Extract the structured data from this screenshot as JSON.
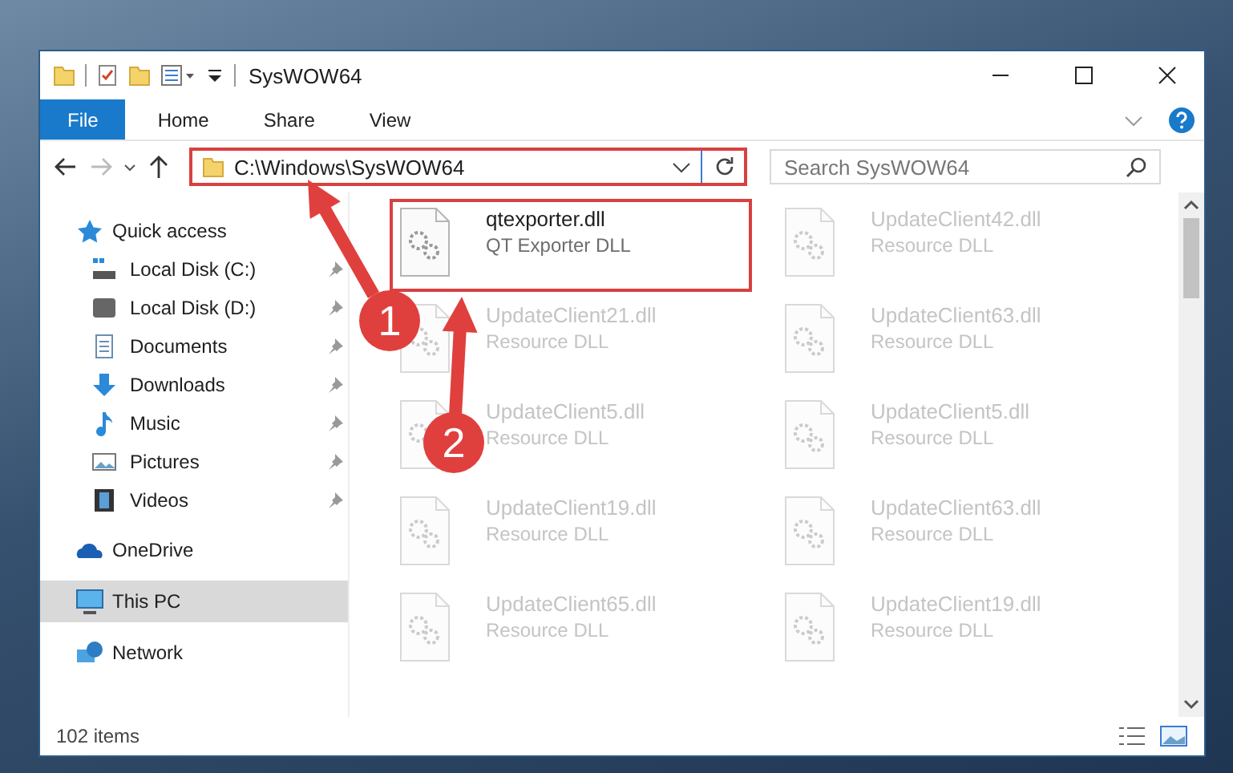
{
  "window": {
    "title": "SysWOW64"
  },
  "ribbon": {
    "tabs": [
      {
        "label": "File",
        "selected": true
      },
      {
        "label": "Home",
        "selected": false
      },
      {
        "label": "Share",
        "selected": false
      },
      {
        "label": "View",
        "selected": false
      }
    ]
  },
  "address_bar": {
    "path": "C:\\Windows\\SysWOW64",
    "highlighted": true
  },
  "search": {
    "placeholder": "Search SysWOW64"
  },
  "sidebar": {
    "items": [
      {
        "label": "Quick access",
        "selected": false,
        "children": [
          {
            "label": "Local Disk (C:)",
            "pinned": true,
            "selected": false
          },
          {
            "label": "Local Disk (D:)",
            "pinned": true,
            "selected": false
          },
          {
            "label": "Documents",
            "pinned": true,
            "selected": false
          },
          {
            "label": "Downloads",
            "pinned": true,
            "selected": false
          },
          {
            "label": "Music",
            "pinned": true,
            "selected": false
          },
          {
            "label": "Pictures",
            "pinned": true,
            "selected": false
          },
          {
            "label": "Videos",
            "pinned": true,
            "selected": false
          }
        ]
      },
      {
        "label": "OneDrive",
        "selected": false
      },
      {
        "label": "This PC",
        "selected": true
      },
      {
        "label": "Network",
        "selected": false
      }
    ]
  },
  "files": [
    {
      "name": "qtexporter.dll",
      "type": "QT Exporter DLL",
      "dimmed": false,
      "highlighted": true
    },
    {
      "name": "UpdateClient42.dll",
      "type": "Resource DLL",
      "dimmed": true,
      "highlighted": false
    },
    {
      "name": "UpdateClient21.dll",
      "type": "Resource DLL",
      "dimmed": true,
      "highlighted": false
    },
    {
      "name": "UpdateClient63.dll",
      "type": "Resource DLL",
      "dimmed": true,
      "highlighted": false
    },
    {
      "name": "UpdateClient5.dll",
      "type": "Resource DLL",
      "dimmed": true,
      "highlighted": false
    },
    {
      "name": "UpdateClient5.dll",
      "type": "Resource DLL",
      "dimmed": true,
      "highlighted": false
    },
    {
      "name": "UpdateClient19.dll",
      "type": "Resource DLL",
      "dimmed": true,
      "highlighted": false
    },
    {
      "name": "UpdateClient63.dll",
      "type": "Resource DLL",
      "dimmed": true,
      "highlighted": false
    },
    {
      "name": "UpdateClient65.dll",
      "type": "Resource DLL",
      "dimmed": true,
      "highlighted": false
    },
    {
      "name": "UpdateClient19.dll",
      "type": "Resource DLL",
      "dimmed": true,
      "highlighted": false
    }
  ],
  "status_bar": {
    "item_count": "102 items"
  },
  "callouts": [
    {
      "number": "1"
    },
    {
      "number": "2"
    }
  ]
}
